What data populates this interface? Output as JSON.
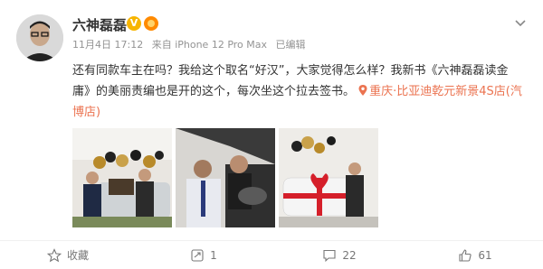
{
  "post": {
    "username": "六神磊磊",
    "verified_mark": "V",
    "meta": {
      "date": "11月4日 17:12",
      "source": "来自 iPhone 12 Pro Max",
      "edited": "已编辑"
    },
    "content": {
      "text": "还有同款车主在吗？我给这个取名“好汉”，大家觉得怎么样？我新书《六神磊磊读金庸》的美丽责编也是开的这个，每次坐这个拉去签书。",
      "location": "重庆·比亚迪乾元新景4S店(汽博店)"
    },
    "photos": [
      {
        "name": "photo-1"
      },
      {
        "name": "photo-2"
      },
      {
        "name": "photo-3"
      }
    ]
  },
  "toolbar": {
    "collect_label": "收藏",
    "repost_count": "1",
    "comment_count": "22",
    "like_count": "61"
  },
  "icons": {
    "more": "chevron-down-icon",
    "location": "location-pin-icon",
    "collect": "star-icon",
    "repost": "repost-icon",
    "comment": "comment-icon",
    "like": "thumbs-up-icon"
  },
  "colors": {
    "accent": "#eb7350",
    "verified": "#f7b500",
    "meta": "#939393"
  }
}
